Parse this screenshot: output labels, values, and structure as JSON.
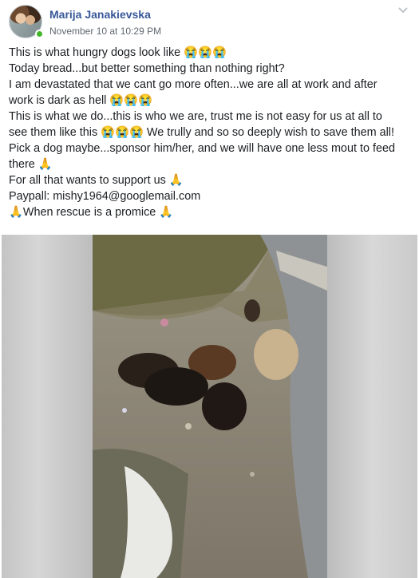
{
  "post": {
    "author": "Marija Janakievska",
    "timestamp": "November 10 at 10:29 PM",
    "lines": [
      "This is what hungry dogs look like 😭😭😭",
      "Today bread...but better something than nothing right?",
      "I am devastated that we cant go more often...we are all at work and after",
      "work is dark as hell 😭😭😭",
      "This is what we do...this is who we are, trust me is not easy for us at all to",
      "see them like this 😭😭😭 We trully and so so deeply wish to save them all!",
      "Pick a dog maybe...sponsor him/her, and we will have one less mout to feed",
      "there 🙏",
      "For all that wants to support us 🙏",
      "Paypall: mishy1964@googlemail.com",
      "🙏When rescue is a promice 🙏"
    ]
  },
  "icons": {
    "avatar": "avatar-photo",
    "online_status": "online-dot",
    "menu": "chevron-down-icon"
  },
  "colors": {
    "author_link": "#385898",
    "online": "#42b72a",
    "meta_text": "#616770"
  }
}
